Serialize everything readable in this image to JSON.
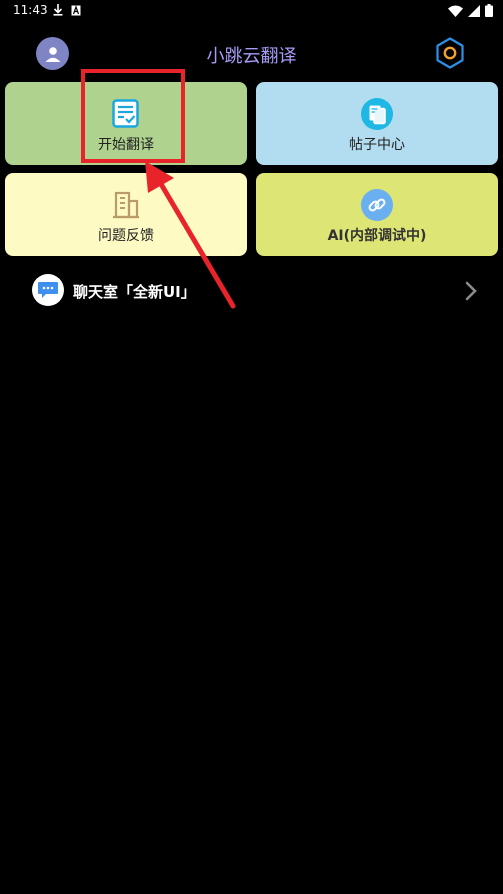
{
  "status_bar": {
    "time": "11:43",
    "icons": [
      "download-icon",
      "a-letter-icon",
      "wifi-icon",
      "signal-icon",
      "battery-icon"
    ]
  },
  "header": {
    "title": "小跳云翻译",
    "avatar_icon": "person-icon",
    "settings_icon": "gear-icon"
  },
  "grid": [
    {
      "label": "开始翻译",
      "icon": "document-check-icon",
      "bg": "#afd28f"
    },
    {
      "label": "帖子中心",
      "icon": "pages-icon",
      "bg": "#b2dcef"
    },
    {
      "label": "问题反馈",
      "icon": "building-icon",
      "bg": "#fefac4"
    },
    {
      "label": "AI(内部调试中)",
      "icon": "link-icon",
      "bg": "#dde575"
    }
  ],
  "chat_row": {
    "label": "聊天室「全新UI」",
    "icon": "chat-bubble-icon",
    "chevron_icon": "chevron-right-icon"
  },
  "colors": {
    "background": "#000000",
    "title": "#a69bf5",
    "annotation": "#e8232a"
  }
}
